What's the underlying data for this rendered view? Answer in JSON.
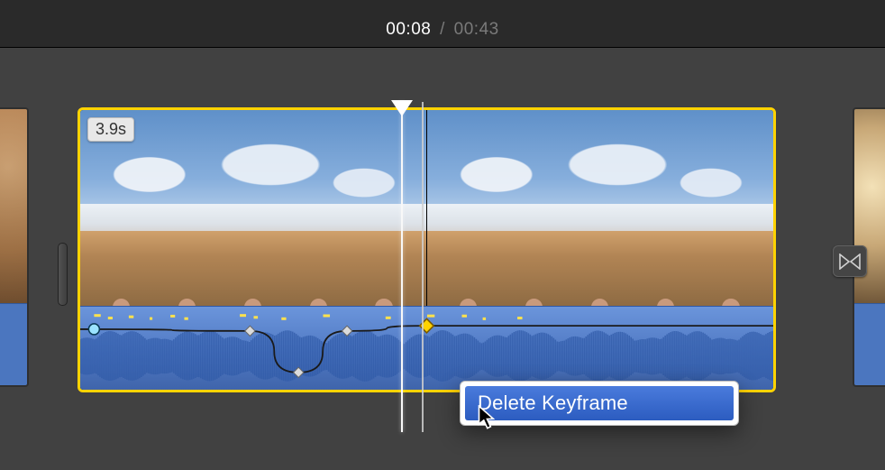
{
  "timecode": {
    "current": "00:08",
    "total": "00:43",
    "separator": "/"
  },
  "clip": {
    "duration_label": "3.9s",
    "people_colors": [
      "#3a7e44",
      "#b73a3a",
      "#4a3f36",
      "#6b8a9c",
      "#4d2f25"
    ],
    "audio": {
      "keyframes": [
        {
          "x_pct": 2,
          "level_pct": 26,
          "shape": "circle",
          "color": "#9be3ff"
        },
        {
          "x_pct": 24.5,
          "level_pct": 28,
          "shape": "diamond",
          "color": "#dcdcdc"
        },
        {
          "x_pct": 31.5,
          "level_pct": 76,
          "shape": "diamond",
          "color": "#dcdcdc"
        },
        {
          "x_pct": 38.5,
          "level_pct": 28,
          "shape": "diamond",
          "color": "#dcdcdc"
        },
        {
          "x_pct": 50,
          "level_pct": 22,
          "shape": "diamond",
          "color": "#ffd300",
          "selected": true
        }
      ],
      "peak_markers_pct": [
        2,
        4,
        7,
        10,
        13,
        15,
        23,
        25,
        29,
        35,
        44,
        50,
        55,
        58,
        63
      ]
    }
  },
  "context_menu": {
    "items": [
      "Delete Keyframe"
    ]
  },
  "icons": {
    "transition": "crossfade"
  }
}
